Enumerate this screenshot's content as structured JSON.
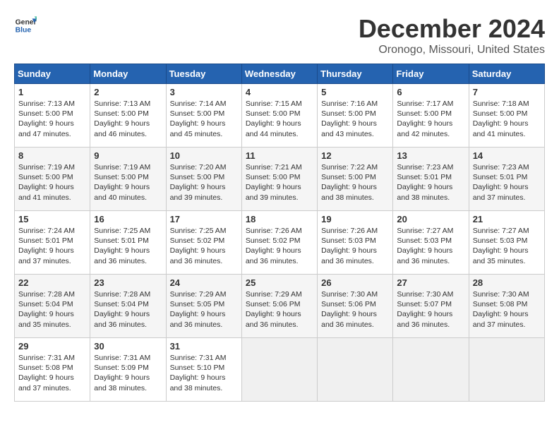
{
  "logo": {
    "text_general": "General",
    "text_blue": "Blue"
  },
  "title": "December 2024",
  "subtitle": "Oronogo, Missouri, United States",
  "headers": [
    "Sunday",
    "Monday",
    "Tuesday",
    "Wednesday",
    "Thursday",
    "Friday",
    "Saturday"
  ],
  "weeks": [
    [
      {
        "day": "1",
        "sunrise": "Sunrise: 7:13 AM",
        "sunset": "Sunset: 5:00 PM",
        "daylight": "Daylight: 9 hours and 47 minutes."
      },
      {
        "day": "2",
        "sunrise": "Sunrise: 7:13 AM",
        "sunset": "Sunset: 5:00 PM",
        "daylight": "Daylight: 9 hours and 46 minutes."
      },
      {
        "day": "3",
        "sunrise": "Sunrise: 7:14 AM",
        "sunset": "Sunset: 5:00 PM",
        "daylight": "Daylight: 9 hours and 45 minutes."
      },
      {
        "day": "4",
        "sunrise": "Sunrise: 7:15 AM",
        "sunset": "Sunset: 5:00 PM",
        "daylight": "Daylight: 9 hours and 44 minutes."
      },
      {
        "day": "5",
        "sunrise": "Sunrise: 7:16 AM",
        "sunset": "Sunset: 5:00 PM",
        "daylight": "Daylight: 9 hours and 43 minutes."
      },
      {
        "day": "6",
        "sunrise": "Sunrise: 7:17 AM",
        "sunset": "Sunset: 5:00 PM",
        "daylight": "Daylight: 9 hours and 42 minutes."
      },
      {
        "day": "7",
        "sunrise": "Sunrise: 7:18 AM",
        "sunset": "Sunset: 5:00 PM",
        "daylight": "Daylight: 9 hours and 41 minutes."
      }
    ],
    [
      {
        "day": "8",
        "sunrise": "Sunrise: 7:19 AM",
        "sunset": "Sunset: 5:00 PM",
        "daylight": "Daylight: 9 hours and 41 minutes."
      },
      {
        "day": "9",
        "sunrise": "Sunrise: 7:19 AM",
        "sunset": "Sunset: 5:00 PM",
        "daylight": "Daylight: 9 hours and 40 minutes."
      },
      {
        "day": "10",
        "sunrise": "Sunrise: 7:20 AM",
        "sunset": "Sunset: 5:00 PM",
        "daylight": "Daylight: 9 hours and 39 minutes."
      },
      {
        "day": "11",
        "sunrise": "Sunrise: 7:21 AM",
        "sunset": "Sunset: 5:00 PM",
        "daylight": "Daylight: 9 hours and 39 minutes."
      },
      {
        "day": "12",
        "sunrise": "Sunrise: 7:22 AM",
        "sunset": "Sunset: 5:00 PM",
        "daylight": "Daylight: 9 hours and 38 minutes."
      },
      {
        "day": "13",
        "sunrise": "Sunrise: 7:23 AM",
        "sunset": "Sunset: 5:01 PM",
        "daylight": "Daylight: 9 hours and 38 minutes."
      },
      {
        "day": "14",
        "sunrise": "Sunrise: 7:23 AM",
        "sunset": "Sunset: 5:01 PM",
        "daylight": "Daylight: 9 hours and 37 minutes."
      }
    ],
    [
      {
        "day": "15",
        "sunrise": "Sunrise: 7:24 AM",
        "sunset": "Sunset: 5:01 PM",
        "daylight": "Daylight: 9 hours and 37 minutes."
      },
      {
        "day": "16",
        "sunrise": "Sunrise: 7:25 AM",
        "sunset": "Sunset: 5:01 PM",
        "daylight": "Daylight: 9 hours and 36 minutes."
      },
      {
        "day": "17",
        "sunrise": "Sunrise: 7:25 AM",
        "sunset": "Sunset: 5:02 PM",
        "daylight": "Daylight: 9 hours and 36 minutes."
      },
      {
        "day": "18",
        "sunrise": "Sunrise: 7:26 AM",
        "sunset": "Sunset: 5:02 PM",
        "daylight": "Daylight: 9 hours and 36 minutes."
      },
      {
        "day": "19",
        "sunrise": "Sunrise: 7:26 AM",
        "sunset": "Sunset: 5:03 PM",
        "daylight": "Daylight: 9 hours and 36 minutes."
      },
      {
        "day": "20",
        "sunrise": "Sunrise: 7:27 AM",
        "sunset": "Sunset: 5:03 PM",
        "daylight": "Daylight: 9 hours and 36 minutes."
      },
      {
        "day": "21",
        "sunrise": "Sunrise: 7:27 AM",
        "sunset": "Sunset: 5:03 PM",
        "daylight": "Daylight: 9 hours and 35 minutes."
      }
    ],
    [
      {
        "day": "22",
        "sunrise": "Sunrise: 7:28 AM",
        "sunset": "Sunset: 5:04 PM",
        "daylight": "Daylight: 9 hours and 35 minutes."
      },
      {
        "day": "23",
        "sunrise": "Sunrise: 7:28 AM",
        "sunset": "Sunset: 5:04 PM",
        "daylight": "Daylight: 9 hours and 36 minutes."
      },
      {
        "day": "24",
        "sunrise": "Sunrise: 7:29 AM",
        "sunset": "Sunset: 5:05 PM",
        "daylight": "Daylight: 9 hours and 36 minutes."
      },
      {
        "day": "25",
        "sunrise": "Sunrise: 7:29 AM",
        "sunset": "Sunset: 5:06 PM",
        "daylight": "Daylight: 9 hours and 36 minutes."
      },
      {
        "day": "26",
        "sunrise": "Sunrise: 7:30 AM",
        "sunset": "Sunset: 5:06 PM",
        "daylight": "Daylight: 9 hours and 36 minutes."
      },
      {
        "day": "27",
        "sunrise": "Sunrise: 7:30 AM",
        "sunset": "Sunset: 5:07 PM",
        "daylight": "Daylight: 9 hours and 36 minutes."
      },
      {
        "day": "28",
        "sunrise": "Sunrise: 7:30 AM",
        "sunset": "Sunset: 5:08 PM",
        "daylight": "Daylight: 9 hours and 37 minutes."
      }
    ],
    [
      {
        "day": "29",
        "sunrise": "Sunrise: 7:31 AM",
        "sunset": "Sunset: 5:08 PM",
        "daylight": "Daylight: 9 hours and 37 minutes."
      },
      {
        "day": "30",
        "sunrise": "Sunrise: 7:31 AM",
        "sunset": "Sunset: 5:09 PM",
        "daylight": "Daylight: 9 hours and 38 minutes."
      },
      {
        "day": "31",
        "sunrise": "Sunrise: 7:31 AM",
        "sunset": "Sunset: 5:10 PM",
        "daylight": "Daylight: 9 hours and 38 minutes."
      },
      null,
      null,
      null,
      null
    ]
  ]
}
